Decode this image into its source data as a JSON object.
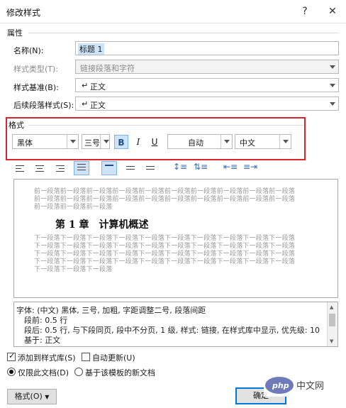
{
  "dialog": {
    "title": "修改样式",
    "help": "?",
    "close": "✕"
  },
  "properties": {
    "section_label": "属性",
    "name_label": "名称(N):",
    "name_value": "标题 1",
    "style_type_label": "样式类型(T):",
    "style_type_value": "链接段落和字符",
    "based_on_label": "样式基准(B):",
    "based_on_value": "正文",
    "next_label": "后续段落样式(S):",
    "next_value": "正文"
  },
  "format": {
    "section_label": "格式",
    "font": "黑体",
    "size": "三号",
    "bold": "B",
    "italic": "I",
    "underline": "U",
    "color": "自动",
    "script": "中文"
  },
  "preview": {
    "before_lines": [
      "前一段落前一段落前一段落前一段落前一段落前一段落前一段落前一段落前一段落前一段落",
      "前一段落前一段落前一段落前一段落前一段落前一段落前一段落前一段落前一段落前一段落",
      "前一段落前一段落前一段落"
    ],
    "heading": "第 1 章　计算机概述",
    "after_lines": [
      "下一段落下一段落下一段落下一段落下一段落下一段落下一段落下一段落下一段落下一段落",
      "下一段落下一段落下一段落下一段落下一段落下一段落下一段落下一段落下一段落下一段落",
      "下一段落下一段落下一段落下一段落下一段落下一段落下一段落下一段落下一段落下一段落",
      "下一段落下一段落下一段落下一段落下一段落下一段落下一段落下一段落下一段落下一段落",
      "下一段落下一段落下一段落"
    ]
  },
  "description": {
    "line1": "字体: (中文) 黑体, 三号, 加粗, 字距调整二号, 段落间距",
    "line2": "段前: 0.5 行",
    "line3": "段后: 0.5 行, 与下段同页, 段中不分页, 1 级, 样式: 链接, 在样式库中显示, 优先级: 10",
    "line4": "基于: 正文"
  },
  "options": {
    "add_to_gallery": "添加到样式库(S)",
    "auto_update": "自动更新(U)",
    "only_this_doc": "仅限此文档(D)",
    "new_docs_template": "基于该模板的新文档"
  },
  "buttons": {
    "format": "格式(O)",
    "ok": "确定"
  },
  "colors": {
    "highlight_frame": "#d3262d",
    "accent": "#0078d7"
  }
}
